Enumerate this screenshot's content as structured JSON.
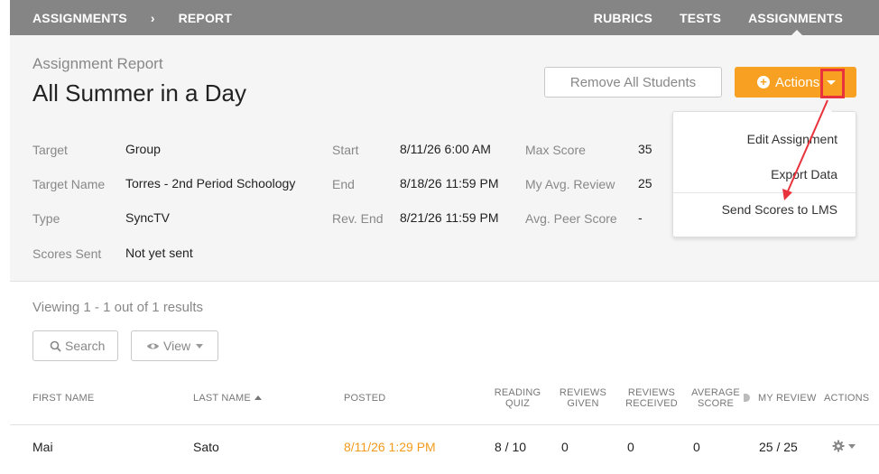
{
  "nav": {
    "breadcrumb": [
      "ASSIGNMENTS",
      "REPORT"
    ],
    "separator": "›",
    "right_links": [
      "RUBRICS",
      "TESTS",
      "ASSIGNMENTS"
    ],
    "active": "ASSIGNMENTS"
  },
  "header": {
    "subtitle": "Assignment Report",
    "title": "All Summer in a Day",
    "remove_button": "Remove All Students",
    "actions_button": "Actions"
  },
  "actions_menu": {
    "items": [
      "Edit Assignment",
      "Export Data",
      "Send Scores to LMS"
    ]
  },
  "info": {
    "target_label": "Target",
    "target_value": "Group",
    "target_name_label": "Target Name",
    "target_name_value": "Torres - 2nd Period Schoology",
    "type_label": "Type",
    "type_value": "SyncTV",
    "scores_sent_label": "Scores Sent",
    "scores_sent_value": "Not yet sent",
    "start_label": "Start",
    "start_value": "8/11/26 6:00 AM",
    "end_label": "End",
    "end_value": "8/18/26 11:59 PM",
    "rev_end_label": "Rev. End",
    "rev_end_value": "8/21/26 11:59 PM",
    "max_score_label": "Max Score",
    "max_score_value": "35",
    "my_avg_review_label": "My Avg. Review",
    "my_avg_review_value": "25",
    "avg_peer_score_label": "Avg. Peer Score",
    "avg_peer_score_value": "-"
  },
  "list": {
    "viewing_text": "Viewing 1 - 1 out of 1 results",
    "search_button": "Search",
    "view_button": "View",
    "columns": {
      "first_name": "FIRST NAME",
      "last_name": "LAST NAME",
      "posted": "POSTED",
      "reading_quiz": "READING QUIZ",
      "reviews_given": "REVIEWS GIVEN",
      "reviews_received": "REVIEWS RECEIVED",
      "average_score": "AVERAGE SCORE",
      "my_review": "MY REVIEW",
      "actions": "ACTIONS"
    },
    "rows": [
      {
        "first_name": "Mai",
        "last_name": "Sato",
        "posted": "8/11/26 1:29 PM",
        "reading_quiz": "8 / 10",
        "reviews_given": "0",
        "reviews_received": "0",
        "average_score": "0",
        "my_review": "25 / 25"
      }
    ]
  },
  "colors": {
    "nav_bg": "#858585",
    "accent": "#f7a021",
    "highlight": "#e8323c",
    "panel_bg": "#f5f5f5"
  }
}
